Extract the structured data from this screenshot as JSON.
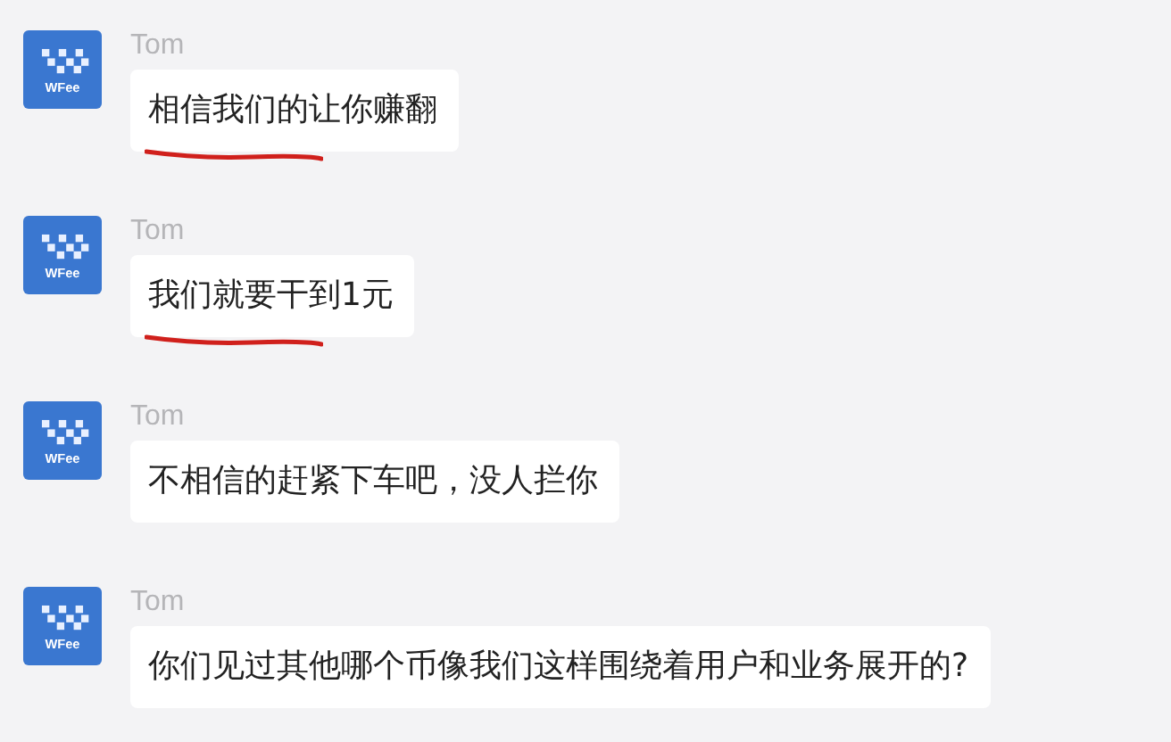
{
  "messages": [
    {
      "avatar_text": "WFee",
      "sender": "Tom",
      "text": "相信我们的让你赚翻",
      "underlined": true
    },
    {
      "avatar_text": "WFee",
      "sender": "Tom",
      "text": "我们就要干到1元",
      "underlined": true
    },
    {
      "avatar_text": "WFee",
      "sender": "Tom",
      "text": "不相信的赶紧下车吧，没人拦你",
      "underlined": false
    },
    {
      "avatar_text": "WFee",
      "sender": "Tom",
      "text": "你们见过其他哪个币像我们这样围绕着用户和业务展开的?",
      "underlined": false
    }
  ]
}
